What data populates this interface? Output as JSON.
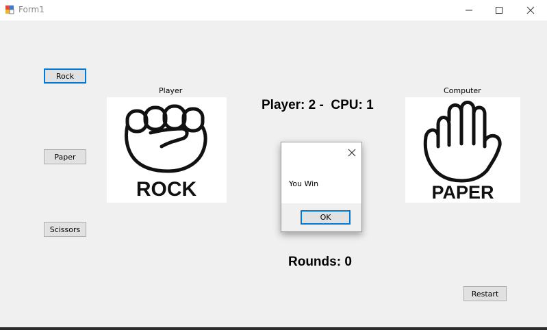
{
  "window": {
    "title": "Form1"
  },
  "buttons": {
    "rock": "Rock",
    "paper": "Paper",
    "scissors": "Scissors",
    "restart": "Restart"
  },
  "player": {
    "label": "Player",
    "choice_text": "ROCK"
  },
  "computer": {
    "label": "Computer",
    "choice_text": "PAPER"
  },
  "score": {
    "text": "Player: 2 -  CPU: 1"
  },
  "rounds": {
    "text": "Rounds: 0"
  },
  "dialog": {
    "message": "You Win",
    "ok_label": "OK"
  }
}
